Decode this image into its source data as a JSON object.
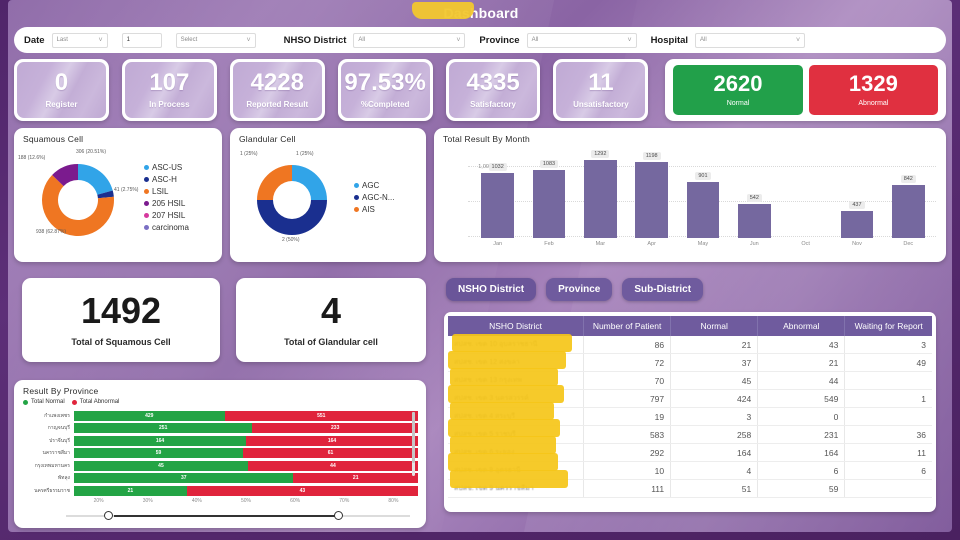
{
  "header": {
    "title_visible": "Dashboard",
    "title_redacted": true
  },
  "filters": {
    "date_label": "Date",
    "date_mode": "Last",
    "date_count": "1",
    "date_unit": "Select",
    "nhso_label": "NHSO District",
    "nhso_value": "All",
    "province_label": "Province",
    "province_value": "All",
    "hospital_label": "Hospital",
    "hospital_value": "All"
  },
  "kpis": [
    {
      "value": "0",
      "label": "Register"
    },
    {
      "value": "107",
      "label": "In Process"
    },
    {
      "value": "4228",
      "label": "Reported Result"
    },
    {
      "value": "97.53%",
      "label": "%Completed"
    },
    {
      "value": "4335",
      "label": "Satisfactory"
    },
    {
      "value": "11",
      "label": "Unsatisfactory"
    }
  ],
  "result_pair": {
    "normal": {
      "value": "2620",
      "label": "Normal",
      "color": "#22a04a"
    },
    "abnormal": {
      "value": "1329",
      "label": "Abnormal",
      "color": "#e03040"
    }
  },
  "chart_data": [
    {
      "type": "pie",
      "id": "squamous",
      "title": "Squamous Cell",
      "legend_position": "right",
      "categories": [
        "ASC-US",
        "ASC-H",
        "LSIL",
        "205 HSIL",
        "207 HSIL",
        "carcinoma"
      ],
      "values": [
        306,
        41,
        938,
        188,
        0,
        0
      ],
      "percents": [
        "20.51%",
        "2.75%",
        "62.87%",
        "12.6%",
        "",
        ""
      ],
      "labels": [
        "306 (20.51%)",
        "41 (2.75%)",
        "938 (62.87%)",
        "188 (12.6%)"
      ],
      "colors": [
        "#31a4e8",
        "#1a2f8f",
        "#ef7622",
        "#7b1b8e",
        "#d6399e",
        "#7b6fc4"
      ],
      "total": 1492
    },
    {
      "type": "pie",
      "id": "glandular",
      "title": "Glandular Cell",
      "legend_position": "right",
      "categories": [
        "AGC",
        "AGC-N...",
        "AIS"
      ],
      "values": [
        1,
        2,
        1
      ],
      "percents": [
        "25%",
        "50%",
        "25%"
      ],
      "labels": [
        "1 (25%)",
        "2 (50%)",
        "1 (25%)"
      ],
      "colors": [
        "#31a4e8",
        "#1a2f8f",
        "#ef7622"
      ],
      "total": 4
    },
    {
      "type": "bar",
      "id": "month",
      "title": "Total Result By Month",
      "categories": [
        "Jan",
        "Feb",
        "Mar",
        "Apr",
        "May",
        "Jun",
        "Oct",
        "Nov",
        "Dec"
      ],
      "values": [
        1032,
        1083,
        1292,
        1198,
        901,
        542,
        null,
        437,
        842
      ],
      "yticks": [
        "0",
        "500",
        "1,000"
      ],
      "ylim": [
        0,
        1400
      ],
      "bar_color": "#75689f",
      "xlabel": "",
      "ylabel": ""
    },
    {
      "type": "bar",
      "id": "province",
      "title": "Result By Province",
      "orientation": "horizontal",
      "stacked": true,
      "legend": [
        "Total Normal",
        "Total Abnormal"
      ],
      "legend_colors": [
        "#23a445",
        "#e0243c"
      ],
      "categories": [
        "กำแพงเพชร",
        "กาญจนบุรี",
        "ปราจีนบุรี",
        "นครราชสีมา",
        "กรุงเทพมหานคร",
        "พัทลุง",
        "นครศรีธรรมราช"
      ],
      "series": [
        {
          "name": "Total Normal",
          "values": [
            429,
            251,
            164,
            59,
            45,
            37,
            21
          ]
        },
        {
          "name": "Total Abnormal",
          "values": [
            551,
            233,
            164,
            61,
            44,
            21,
            43
          ]
        }
      ],
      "xticks": [
        "20%",
        "30%",
        "40%",
        "50%",
        "60%",
        "70%",
        "80%"
      ]
    }
  ],
  "totals": {
    "squamous": {
      "value": "1492",
      "label": "Total of  Squamous Cell"
    },
    "glandular": {
      "value": "4",
      "label": "Total of Glandular cell"
    }
  },
  "right_panel": {
    "tabs": [
      {
        "label": "NSHO District",
        "active": true
      },
      {
        "label": "Province",
        "active": false
      },
      {
        "label": "Sub-District",
        "active": false
      }
    ],
    "table": {
      "columns": [
        "NSHO District",
        "Number of Patient",
        "Normal",
        "Abnormal",
        "Waiting for Report"
      ],
      "rows": [
        {
          "name": "สปสช. เขต 10 อุบลราชธานี",
          "patients": "86",
          "normal": "21",
          "abnormal": "43",
          "waiting": "3"
        },
        {
          "name": "สปสช. เขต 12 สงขลา",
          "patients": "72",
          "normal": "37",
          "abnormal": "21",
          "waiting": "49"
        },
        {
          "name": "สปสช. เขต 13 กรุงเทพ",
          "patients": "70",
          "normal": "45",
          "abnormal": "44",
          "waiting": ""
        },
        {
          "name": "สปสช. เขต 3 นครสวรรค์",
          "patients": "797",
          "normal": "424",
          "abnormal": "549",
          "waiting": "1"
        },
        {
          "name": "สปสช. เขต 4 สระบุรี",
          "patients": "19",
          "normal": "3",
          "abnormal": "0",
          "waiting": ""
        },
        {
          "name": "สปสช. เขต 5 ราชบุรี",
          "patients": "583",
          "normal": "258",
          "abnormal": "231",
          "waiting": "36"
        },
        {
          "name": "สปสช. เขต 6 ระยอง",
          "patients": "292",
          "normal": "164",
          "abnormal": "164",
          "waiting": "11"
        },
        {
          "name": "สปสช. เขต 8 อุดรธานี",
          "patients": "10",
          "normal": "4",
          "abnormal": "6",
          "waiting": "6"
        },
        {
          "name": "สปสช. เขต 9 นครราชสีมา",
          "patients": "111",
          "normal": "51",
          "abnormal": "59",
          "waiting": ""
        }
      ]
    }
  },
  "theme": {
    "background": "#8e6aa8",
    "frame": "#50256a",
    "accent": "#6f5b9e",
    "normal_color": "#22a04a",
    "abnormal_color": "#e03040",
    "redaction_color": "#f5c518"
  }
}
